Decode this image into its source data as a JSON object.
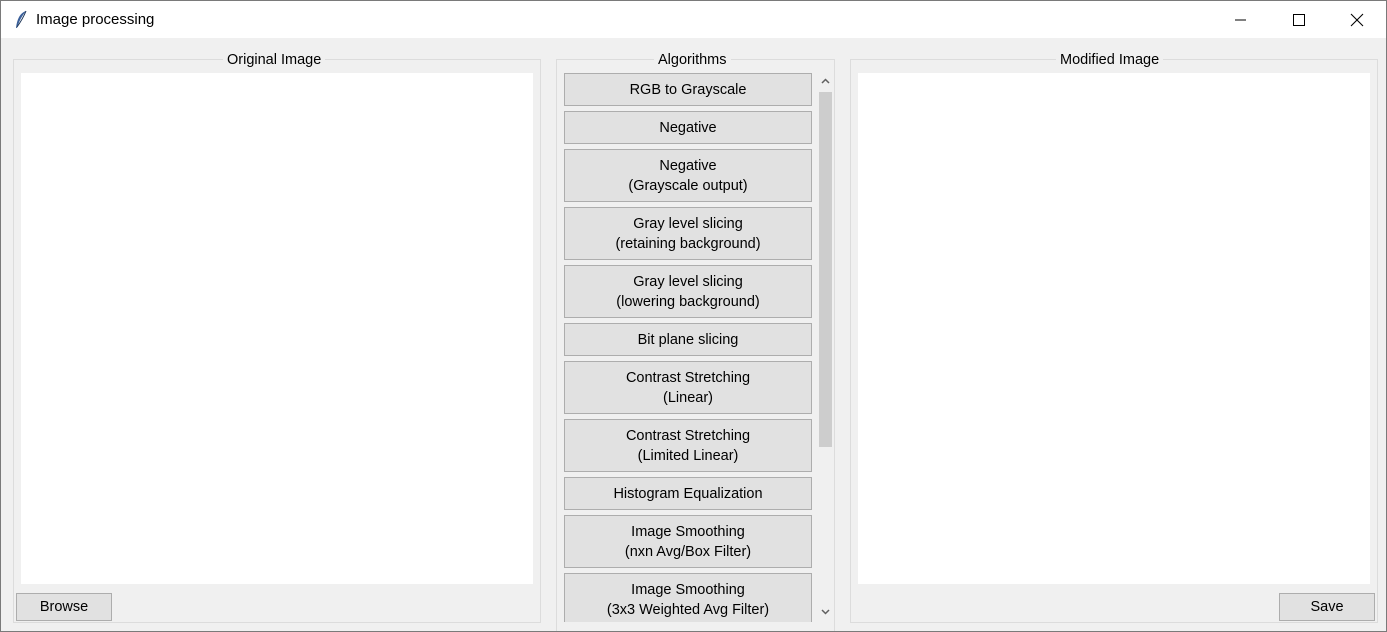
{
  "window": {
    "title": "Image processing"
  },
  "original_panel": {
    "title": "Original Image",
    "browse_label": "Browse"
  },
  "algorithms_panel": {
    "title": "Algorithms",
    "items": [
      {
        "line1": "RGB to Grayscale",
        "line2": ""
      },
      {
        "line1": "Negative",
        "line2": ""
      },
      {
        "line1": "Negative",
        "line2": "(Grayscale output)"
      },
      {
        "line1": "Gray level slicing",
        "line2": "(retaining background)"
      },
      {
        "line1": "Gray level slicing",
        "line2": "(lowering background)"
      },
      {
        "line1": "Bit plane slicing",
        "line2": ""
      },
      {
        "line1": "Contrast Stretching",
        "line2": "(Linear)"
      },
      {
        "line1": "Contrast Stretching",
        "line2": "(Limited Linear)"
      },
      {
        "line1": "Histogram Equalization",
        "line2": ""
      },
      {
        "line1": "Image Smoothing",
        "line2": "(nxn Avg/Box Filter)"
      },
      {
        "line1": "Image Smoothing",
        "line2": "(3x3 Weighted Avg Filter)"
      }
    ]
  },
  "modified_panel": {
    "title": "Modified Image",
    "save_label": "Save"
  },
  "icons": {
    "app": "feather-icon",
    "minimize": "minimize-icon",
    "maximize": "maximize-icon",
    "close": "close-icon",
    "scroll_up": "chevron-up-icon",
    "scroll_down": "chevron-down-icon"
  }
}
